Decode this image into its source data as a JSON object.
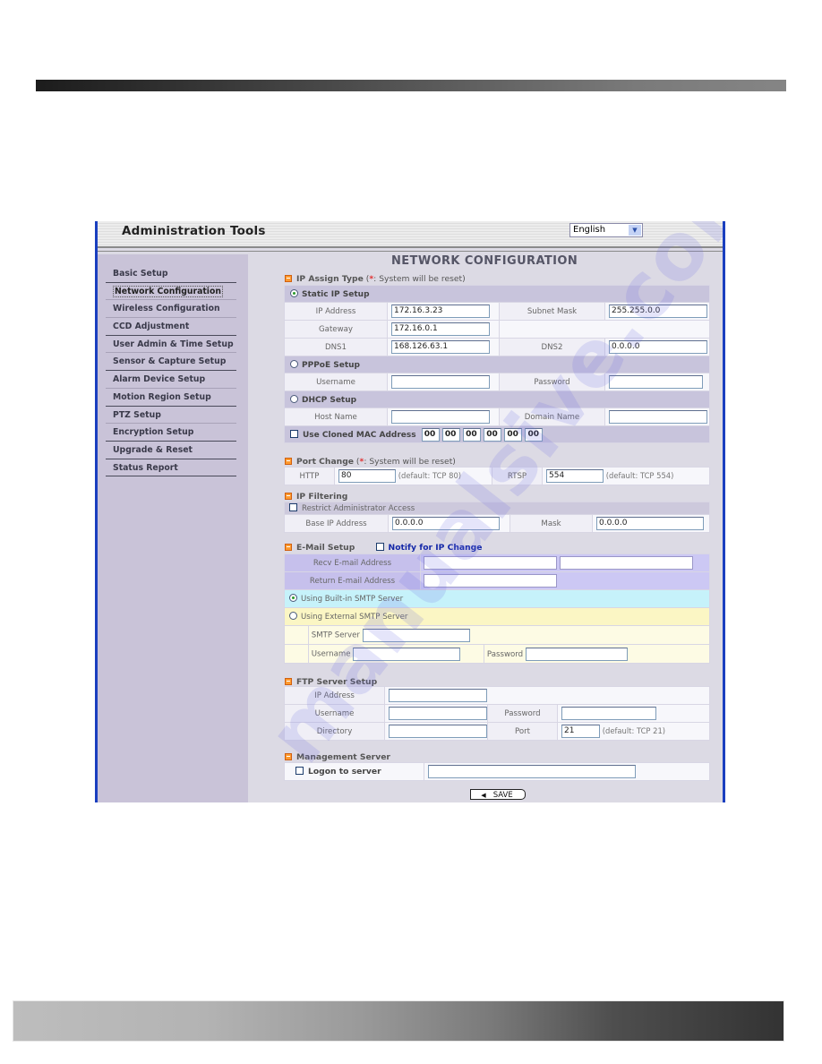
{
  "app": {
    "title": "Administration Tools",
    "language": {
      "selected": "English",
      "arrow_icon": "chevron-down-icon"
    }
  },
  "sidebar": {
    "items": [
      {
        "label": "Basic Setup"
      },
      {
        "label": "Network Configuration",
        "active": true
      },
      {
        "label": "Wireless Configuration"
      },
      {
        "label": "CCD Adjustment"
      },
      {
        "label": "User Admin & Time Setup"
      },
      {
        "label": "Sensor & Capture Setup"
      },
      {
        "label": "Alarm Device Setup"
      },
      {
        "label": "Motion Region Setup"
      },
      {
        "label": "PTZ Setup"
      },
      {
        "label": "Encryption Setup"
      },
      {
        "label": "Upgrade & Reset"
      },
      {
        "label": "Status Report"
      }
    ]
  },
  "page": {
    "title": "NETWORK CONFIGURATION",
    "ip_assign": {
      "heading": "IP Assign Type",
      "note_open": " (",
      "star": "*",
      "note": ": System will be reset)",
      "static": {
        "label": "Static IP Setup",
        "selected": true,
        "ip_label": "IP Address",
        "ip_value": "172.16.3.23",
        "mask_label": "Subnet Mask",
        "mask_value": "255.255.0.0",
        "gateway_label": "Gateway",
        "gateway_value": "172.16.0.1",
        "dns1_label": "DNS1",
        "dns1_value": "168.126.63.1",
        "dns2_label": "DNS2",
        "dns2_value": "0.0.0.0"
      },
      "pppoe": {
        "label": "PPPoE Setup",
        "selected": false,
        "username_label": "Username",
        "username_value": "",
        "password_label": "Password",
        "password_value": ""
      },
      "dhcp": {
        "label": "DHCP Setup",
        "selected": false,
        "host_label": "Host Name",
        "host_value": "",
        "domain_label": "Domain Name",
        "domain_value": ""
      },
      "cloned_mac": {
        "label": "Use Cloned MAC Address",
        "checked": false,
        "octets": [
          "00",
          "00",
          "00",
          "00",
          "00",
          "00"
        ]
      }
    },
    "port_change": {
      "heading": "Port Change",
      "note_open": " (",
      "star": "*",
      "note": ": System will be reset)",
      "http_label": "HTTP",
      "http_value": "80",
      "http_default": "(default: TCP 80)",
      "rtsp_label": "RTSP",
      "rtsp_value": "554",
      "rtsp_default": "(default: TCP 554)"
    },
    "ip_filtering": {
      "heading": "IP Filtering",
      "restrict_label": "Restrict Administrator Access",
      "restrict_checked": false,
      "base_label": "Base IP Address",
      "base_value": "0.0.0.0",
      "mask_label": "Mask",
      "mask_value": "0.0.0.0"
    },
    "email": {
      "heading": "E-Mail Setup",
      "notify_label": "Notify for IP Change",
      "notify_checked": false,
      "recv_label": "Recv E-mail Address",
      "recv_value_1": "",
      "recv_value_2": "",
      "return_label": "Return E-mail Address",
      "return_value": "",
      "builtin_label": "Using Built-in SMTP Server",
      "builtin_selected": true,
      "external_label": "Using External SMTP Server",
      "external_selected": false,
      "smtp_label": "SMTP Server",
      "smtp_value": "",
      "username_label": "Username",
      "username_value": "",
      "password_label": "Password",
      "password_value": ""
    },
    "ftp": {
      "heading": "FTP Server Setup",
      "ip_label": "IP Address",
      "ip_value": "",
      "username_label": "Username",
      "username_value": "",
      "password_label": "Password",
      "password_value": "",
      "directory_label": "Directory",
      "directory_value": "",
      "port_label": "Port",
      "port_value": "21",
      "port_default": "(default: TCP 21)"
    },
    "management": {
      "heading": "Management Server",
      "logon_label": "Logon to server",
      "logon_checked": false,
      "server_value": ""
    },
    "save_label": "SAVE"
  },
  "watermark": "manualsive.com"
}
